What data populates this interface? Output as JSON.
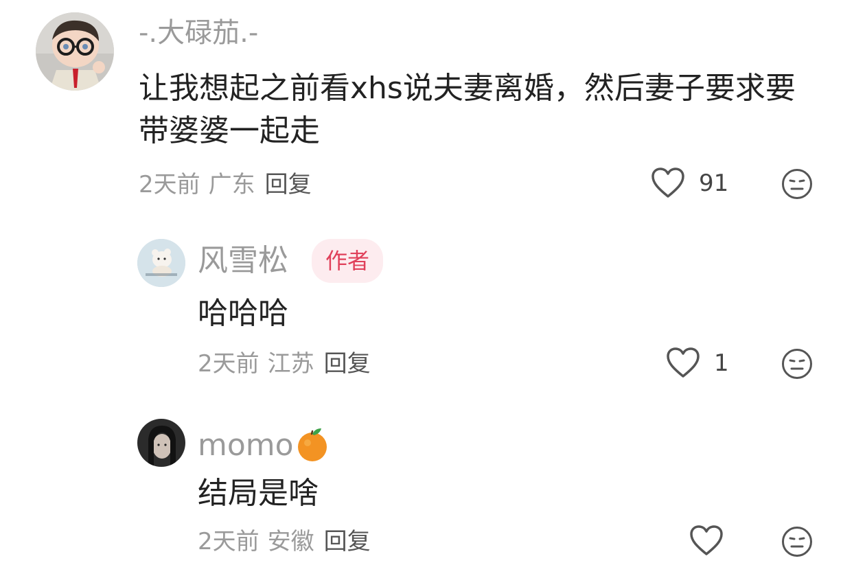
{
  "comments": [
    {
      "username": "-.大碌茄.-",
      "text": "让我想起之前看xhs说夫妻离婚，然后妻子要求要带婆婆一起走",
      "time": "2天前",
      "location": "广东",
      "reply_label": "回复",
      "likes": "91"
    },
    {
      "username": "风雪松",
      "badge": "作者",
      "text": "哈哈哈",
      "time": "2天前",
      "location": "江苏",
      "reply_label": "回复",
      "likes": "1"
    },
    {
      "username": "momo",
      "username_emoji": "orange-emoji",
      "text": "结局是啥",
      "time": "2天前",
      "location": "安徽",
      "reply_label": "回复",
      "likes": ""
    }
  ],
  "icons": {
    "like": "heart-outline-icon",
    "dislike": "neutral-face-icon"
  },
  "colors": {
    "username": "#9a9a9a",
    "text": "#222222",
    "meta": "#9a9a9a",
    "badge_bg": "#fdecef",
    "badge_text": "#e0405a",
    "icon_stroke": "#555555"
  }
}
